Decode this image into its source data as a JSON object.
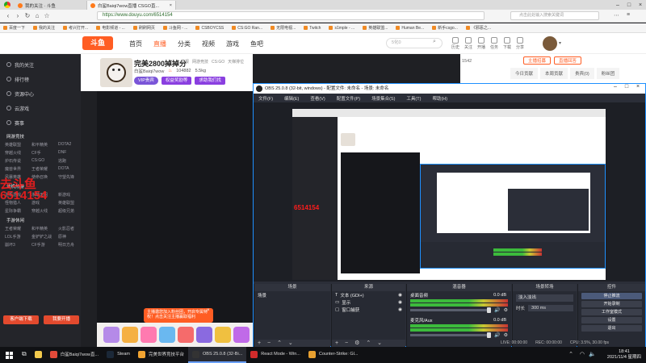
{
  "browser": {
    "tabs": [
      {
        "label": "我的关注 · 斗鱼",
        "active": false
      },
      {
        "label": "白鲨Baiqi7wow直播 CSGO直...",
        "active": true
      }
    ],
    "url": "https://www.douyu.com/6514154",
    "search_placeholder": "点击此处输入搜索关键词",
    "bookmarks": [
      "百度一下",
      "我的关注",
      "考兴打开...",
      "电影频道 - ...",
      "刷刷网页",
      "斗鱼网 - ...",
      "CSBOYCSS",
      "CS:GO Ran...",
      "无限电视...",
      "Twitch",
      "s1mple - ...",
      "英雄联盟...",
      "Human Be...",
      "新手csgo...",
      "《邪恶之..."
    ]
  },
  "douyu": {
    "logo": "斗鱼",
    "nav": [
      "首页",
      "直播",
      "分类",
      "视频",
      "游戏",
      "鱼吧"
    ],
    "search_placeholder": "5化0",
    "header_icons": [
      "历史",
      "关注",
      "开播",
      "任务",
      "下载",
      "分享"
    ],
    "stream_title": "完美2800掉掉分",
    "room_meta": "白鲨Baiqi7wow",
    "room_tags": [
      "举报",
      "网游竞技",
      "CS:GO",
      "天梯排位"
    ],
    "hot_value": "104882",
    "follow_count": "5.5kg",
    "vip_label": "VIP贵宾",
    "btn1": "权益奖励等",
    "btn2": "求助我们找",
    "right_tabs": [
      "今日贡献",
      "本周贡献",
      "贵宾(0)",
      "粉丝团"
    ],
    "right_btns": [
      "主播招募",
      "直播回答",
      "关注"
    ],
    "viewer_count": "1542"
  },
  "sidebar": {
    "main": [
      "我的关注",
      "排行榜",
      "资源中心",
      "云游戏",
      "赛事"
    ],
    "sections": [
      {
        "title": "网游竞技",
        "items": [
          "英雄联盟",
          "和平精英",
          "DOTA2",
          "穿越火线",
          "CF手",
          "DNF",
          "炉石传说",
          "CS:GO",
          "逃跑",
          "魔兽世界",
          "王者荣耀",
          "DOTA",
          "风暴英雄",
          "使命召唤",
          "守望先锋"
        ]
      },
      {
        "title": "单机热游",
        "items": [
          "主机游戏",
          "永劫无间",
          "新游戏",
          "怪物猎人",
          "游戏",
          "英雄联盟",
          "星际争霸",
          "穿越火线",
          "超级兄弟"
        ]
      },
      {
        "title": "手游休闲",
        "items": [
          "王者荣耀",
          "和平精英",
          "火影忍者",
          "LOL手游",
          "金铲铲之战",
          "原神",
          "崩坏3",
          "CF手游",
          "明日方舟"
        ]
      }
    ],
    "bottom_btns": [
      "客户端下载",
      "我要开播"
    ]
  },
  "overlay": {
    "red_text_line1": "去斗鱼",
    "red_text_line2": "6514154",
    "popup": "主播邀您加入粉丝团，开启专属特权！点击关注主播赢取福利"
  },
  "obs": {
    "title": "OBS 25.0.8 (32-bit, windows) - 配置文件: 未命名 - 场景: 未命名",
    "menu": [
      "文件(F)",
      "编辑(E)",
      "查看(V)",
      "配置文件(P)",
      "场景集合(S)",
      "工具(T)",
      "帮助(H)"
    ],
    "docks": {
      "scenes": {
        "title": "场景",
        "items": [
          "场景"
        ]
      },
      "sources": {
        "title": "来源",
        "items": [
          "文本 (GDI+)",
          "显示",
          "窗口捕获"
        ]
      },
      "mixer": {
        "title": "混音器",
        "channels": [
          {
            "name": "桌面音频",
            "db": "0.0 dB"
          },
          {
            "name": "麦克风/Aux",
            "db": "0.0 dB"
          }
        ]
      },
      "transitions": {
        "title": "场景转场",
        "type": "淡入淡出",
        "duration_label": "时长",
        "duration": "300 ms"
      },
      "controls": {
        "title": "控件",
        "buttons": [
          "停止推流",
          "开始录制",
          "工作室模式",
          "设置",
          "退出"
        ]
      }
    },
    "status": {
      "live": "LIVE: 00:00:00",
      "rec": "REC: 00:00:00",
      "cpu": "CPU: 3.5%, 30.00 fps"
    }
  },
  "taskbar": {
    "items": [
      {
        "label": "白鲨Baiqi7wow直...",
        "color": "#e24a3a",
        "active": false
      },
      {
        "label": "Steam",
        "color": "#1b2838",
        "active": false
      },
      {
        "label": "完美世界竞技平台",
        "color": "#f2a431",
        "active": false
      },
      {
        "label": "OBS 25.0.8 (32-Bi...",
        "color": "#333333",
        "active": true
      },
      {
        "label": "React Mode - Win...",
        "color": "#d12b2b",
        "active": false
      },
      {
        "label": "Counter-Strike: Gl...",
        "color": "#e8a030",
        "active": false
      }
    ],
    "time": "18:41",
    "date": "2021/11/4 星期四"
  }
}
